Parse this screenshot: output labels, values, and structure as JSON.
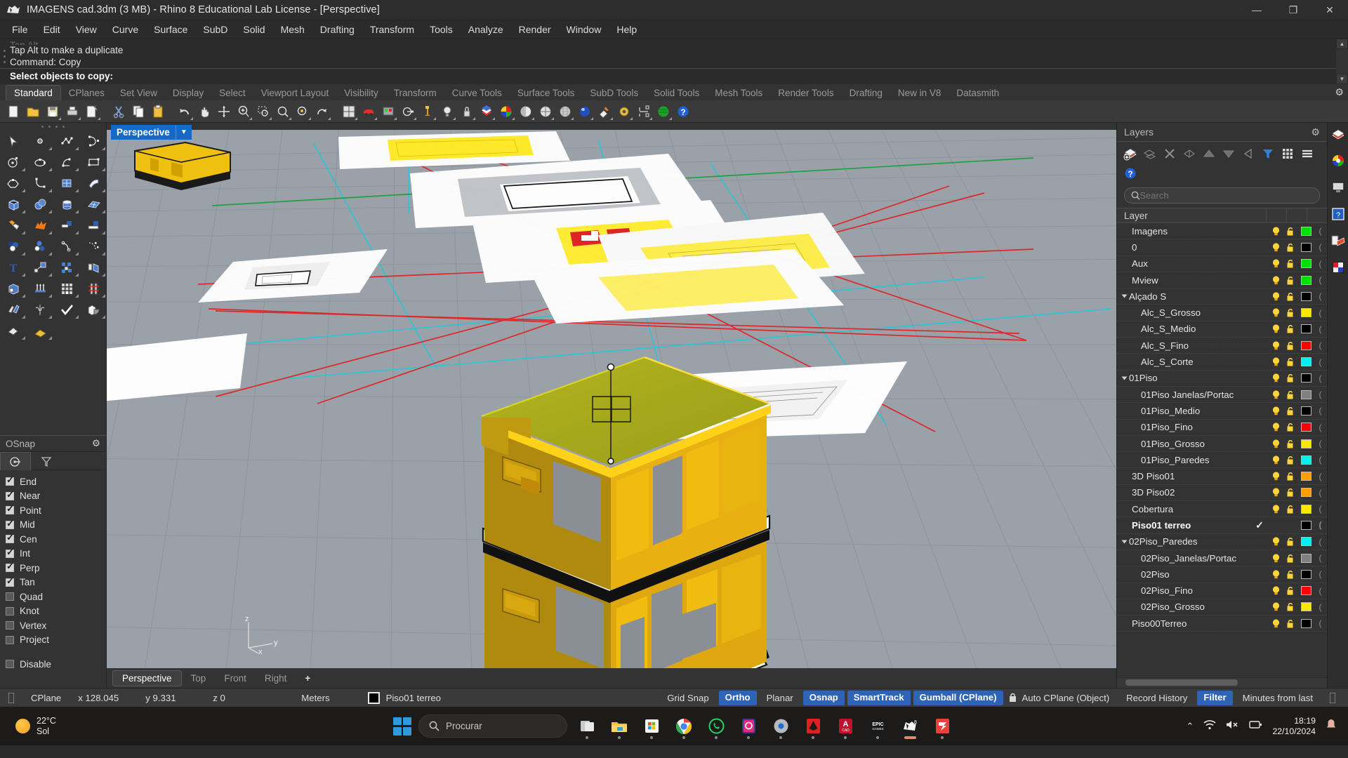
{
  "window": {
    "title": "IMAGENS cad.3dm (3 MB) - Rhino 8 Educational Lab License - [Perspective]",
    "minimize": "—",
    "maximize": "❐",
    "close": "✕"
  },
  "menu": [
    "File",
    "Edit",
    "View",
    "Curve",
    "Surface",
    "SubD",
    "Solid",
    "Mesh",
    "Drafting",
    "Transform",
    "Tools",
    "Analyze",
    "Render",
    "Window",
    "Help"
  ],
  "command": {
    "history": [
      "Tap Alt to make a duplicate",
      "Command: Copy"
    ],
    "prompt": "Select objects to copy:"
  },
  "toolbar_tabs": [
    "Standard",
    "CPlanes",
    "Set View",
    "Display",
    "Select",
    "Viewport Layout",
    "Visibility",
    "Transform",
    "Curve Tools",
    "Surface Tools",
    "SubD Tools",
    "Solid Tools",
    "Mesh Tools",
    "Render Tools",
    "Drafting",
    "New in V8",
    "Datasmith"
  ],
  "toolbar_active_tab": "Standard",
  "toolbar_icons": [
    {
      "name": "new-file-icon"
    },
    {
      "name": "open-file-icon"
    },
    {
      "name": "save-icon"
    },
    {
      "name": "print-icon"
    },
    {
      "name": "save-as-icon"
    },
    {
      "name": "cut-icon"
    },
    {
      "name": "copy-icon"
    },
    {
      "name": "paste-icon"
    },
    {
      "name": "undo-icon"
    },
    {
      "name": "pan-icon"
    },
    {
      "name": "zoom-extents-icon"
    },
    {
      "name": "zoom-window-icon"
    },
    {
      "name": "zoom-selected-icon"
    },
    {
      "name": "zoom-dynamic-icon"
    },
    {
      "name": "zoom-target-icon"
    },
    {
      "name": "rotate-view-icon"
    },
    {
      "name": "four-view-icon"
    },
    {
      "name": "render-icon"
    },
    {
      "name": "shaded-view-icon"
    },
    {
      "name": "cplane-icon"
    },
    {
      "name": "gumball-icon"
    },
    {
      "name": "light-icon"
    },
    {
      "name": "lock-icon"
    },
    {
      "name": "layer-icon"
    },
    {
      "name": "color-wheel-icon"
    },
    {
      "name": "shade-icon"
    },
    {
      "name": "ghosted-icon"
    },
    {
      "name": "xray-icon"
    },
    {
      "name": "render-preview-icon"
    },
    {
      "name": "spotlight-icon"
    },
    {
      "name": "options-gear-icon"
    },
    {
      "name": "dimension-icon"
    },
    {
      "name": "zebra-icon"
    },
    {
      "name": "help-icon"
    }
  ],
  "left_tools": [
    "select-arrow-icon",
    "point-icon",
    "polyline-icon",
    "curve-icon",
    "circle-icon",
    "ellipse-icon",
    "arc-icon",
    "rectangle-icon",
    "polygon-icon",
    "fillet-curve-icon",
    "surface-patch-icon",
    "surface-sweep-icon",
    "box-icon",
    "sphere-icon",
    "cylinder-icon",
    "surface-plane-icon",
    "boolean-union-icon",
    "explode-icon",
    "extrude-surface-icon",
    "extrude-curve-icon",
    "boolean-difference-icon",
    "boolean-intersect-icon",
    "offset-curve-icon",
    "offset-dotted-icon",
    "text-icon",
    "scale-icon",
    "array-icon",
    "mirror-icon",
    "cap-solid-icon",
    "extrude-multi-icon",
    "array-grid-icon",
    "split-icon",
    "split-surface-icon",
    "flow-icon",
    "check-objects-icon",
    "boolean-solid-icon",
    "paint-bucket-icon",
    "layer-state-icon"
  ],
  "osnap": {
    "title": "OSnap",
    "items": [
      {
        "label": "End",
        "checked": true
      },
      {
        "label": "Near",
        "checked": true
      },
      {
        "label": "Point",
        "checked": true
      },
      {
        "label": "Mid",
        "checked": true
      },
      {
        "label": "Cen",
        "checked": true
      },
      {
        "label": "Int",
        "checked": true
      },
      {
        "label": "Perp",
        "checked": true
      },
      {
        "label": "Tan",
        "checked": true
      },
      {
        "label": "Quad",
        "checked": false
      },
      {
        "label": "Knot",
        "checked": false
      },
      {
        "label": "Vertex",
        "checked": false
      },
      {
        "label": "Project",
        "checked": false
      }
    ],
    "disable": {
      "label": "Disable",
      "checked": false
    }
  },
  "viewport": {
    "title": "Perspective",
    "tabs": [
      "Perspective",
      "Top",
      "Front",
      "Right"
    ],
    "active_tab": "Perspective",
    "add_tab": "+",
    "axis": {
      "x": "x",
      "y": "y",
      "z": "z"
    }
  },
  "layers": {
    "title": "Layers",
    "search_placeholder": "Search",
    "column_header": "Layer",
    "tools": [
      "new-layer-icon",
      "new-sublayer-icon",
      "delete-layer-icon",
      "copy-layer-icon",
      "move-up-icon",
      "move-down-icon",
      "select-objects-icon",
      "filter-icon",
      "grid-view-icon",
      "menu-icon",
      "layer-book-icon",
      "help-icon"
    ],
    "rows": [
      {
        "name": "Imagens",
        "indent": 1,
        "expand": false,
        "current": false,
        "bulb": true,
        "lock": true,
        "color": "#00e000"
      },
      {
        "name": "0",
        "indent": 1,
        "expand": false,
        "current": false,
        "bulb": true,
        "lock": true,
        "color": "#000000"
      },
      {
        "name": "Aux",
        "indent": 1,
        "expand": false,
        "current": false,
        "bulb": true,
        "lock": true,
        "color": "#00e000"
      },
      {
        "name": "Mview",
        "indent": 1,
        "expand": false,
        "current": false,
        "bulb": true,
        "lock": true,
        "color": "#00e000"
      },
      {
        "name": "Alçado S",
        "indent": 0,
        "expand": true,
        "current": false,
        "bulb": true,
        "lock": true,
        "color": "#000000"
      },
      {
        "name": "Alc_S_Grosso",
        "indent": 2,
        "expand": false,
        "current": false,
        "bulb": true,
        "lock": true,
        "color": "#ffe800"
      },
      {
        "name": "Alc_S_Medio",
        "indent": 2,
        "expand": false,
        "current": false,
        "bulb": true,
        "lock": true,
        "color": "#000000"
      },
      {
        "name": "Alc_S_Fino",
        "indent": 2,
        "expand": false,
        "current": false,
        "bulb": true,
        "lock": true,
        "color": "#ff0000"
      },
      {
        "name": "Alc_S_Corte",
        "indent": 2,
        "expand": false,
        "current": false,
        "bulb": true,
        "lock": true,
        "color": "#00f0f0"
      },
      {
        "name": "01Piso",
        "indent": 0,
        "expand": true,
        "current": false,
        "bulb": true,
        "lock": true,
        "color": "#000000"
      },
      {
        "name": "01Piso Janelas/Portac",
        "indent": 2,
        "expand": false,
        "current": false,
        "bulb": true,
        "lock": true,
        "color": "#808080"
      },
      {
        "name": "01Piso_Medio",
        "indent": 2,
        "expand": false,
        "current": false,
        "bulb": true,
        "lock": true,
        "color": "#000000"
      },
      {
        "name": "01Piso_Fino",
        "indent": 2,
        "expand": false,
        "current": false,
        "bulb": true,
        "lock": true,
        "color": "#ff0000"
      },
      {
        "name": "01Piso_Grosso",
        "indent": 2,
        "expand": false,
        "current": false,
        "bulb": true,
        "lock": true,
        "color": "#ffe800"
      },
      {
        "name": "01Piso_Paredes",
        "indent": 2,
        "expand": false,
        "current": false,
        "bulb": true,
        "lock": true,
        "color": "#00f0f0"
      },
      {
        "name": "3D Piso01",
        "indent": 1,
        "expand": false,
        "current": false,
        "bulb": true,
        "lock": true,
        "color": "#ffa000"
      },
      {
        "name": "3D Piso02",
        "indent": 1,
        "expand": false,
        "current": false,
        "bulb": true,
        "lock": true,
        "color": "#ffa000"
      },
      {
        "name": "Cobertura",
        "indent": 1,
        "expand": false,
        "current": false,
        "bulb": true,
        "lock": true,
        "color": "#ffe800"
      },
      {
        "name": "Piso01 terreo",
        "indent": 1,
        "expand": false,
        "current": true,
        "bulb": false,
        "lock": false,
        "color": "#000000"
      },
      {
        "name": "02Piso_Paredes",
        "indent": 0,
        "expand": true,
        "current": false,
        "bulb": true,
        "lock": true,
        "color": "#00f0f0"
      },
      {
        "name": "02Piso_Janelas/Portac",
        "indent": 2,
        "expand": false,
        "current": false,
        "bulb": true,
        "lock": true,
        "color": "#808080"
      },
      {
        "name": "02Piso",
        "indent": 2,
        "expand": false,
        "current": false,
        "bulb": true,
        "lock": true,
        "color": "#000000"
      },
      {
        "name": "02Piso_Fino",
        "indent": 2,
        "expand": false,
        "current": false,
        "bulb": true,
        "lock": true,
        "color": "#ff0000"
      },
      {
        "name": "02Piso_Grosso",
        "indent": 2,
        "expand": false,
        "current": false,
        "bulb": true,
        "lock": true,
        "color": "#ffe800"
      },
      {
        "name": "Piso00Terreo",
        "indent": 1,
        "expand": false,
        "current": false,
        "bulb": true,
        "lock": true,
        "color": "#000000"
      }
    ]
  },
  "sidestrip": [
    "layer-panel-icon",
    "color-wheel-icon",
    "display-panel-icon",
    "help-panel-icon",
    "notes-panel-icon",
    "swatch-panel-icon"
  ],
  "statusbar": {
    "cplane_label": "CPlane",
    "x": "x 128.045",
    "y": "y 9.331",
    "z": "z 0",
    "units": "Meters",
    "layer_swatch": "#000000",
    "layer_name": "Piso01 terreo",
    "toggles": [
      {
        "label": "Grid Snap",
        "on": false
      },
      {
        "label": "Ortho",
        "on": true
      },
      {
        "label": "Planar",
        "on": false
      },
      {
        "label": "Osnap",
        "on": true
      },
      {
        "label": "SmartTrack",
        "on": true
      },
      {
        "label": "Gumball (CPlane)",
        "on": true
      }
    ],
    "auto_cplane": "Auto CPlane (Object)",
    "record_history": "Record History",
    "filter": "Filter",
    "minutes": "Minutes from last"
  },
  "taskbar": {
    "weather_temp": "22°C",
    "weather_desc": "Sol",
    "search_placeholder": "Procurar",
    "apps": [
      {
        "name": "task-view-icon"
      },
      {
        "name": "file-explorer-icon"
      },
      {
        "name": "microsoft-store-icon"
      },
      {
        "name": "google-chrome-icon"
      },
      {
        "name": "whatsapp-icon"
      },
      {
        "name": "photos-icon"
      },
      {
        "name": "settings-icon"
      },
      {
        "name": "inkscape-icon"
      },
      {
        "name": "autocad-icon"
      },
      {
        "name": "epic-games-icon"
      },
      {
        "name": "rhino8-icon"
      },
      {
        "name": "sketchup-icon"
      }
    ],
    "time": "18:19",
    "date": "22/10/2024"
  }
}
